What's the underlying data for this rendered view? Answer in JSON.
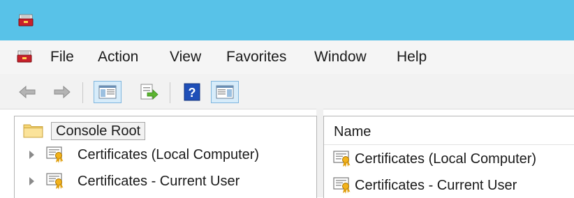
{
  "window": {
    "icon": "mmc-toolbox-icon"
  },
  "menu": {
    "icon": "mmc-toolbox-icon",
    "items": [
      "File",
      "Action",
      "View",
      "Favorites",
      "Window",
      "Help"
    ]
  },
  "toolbar": {
    "buttons": [
      "back-arrow-icon",
      "forward-arrow-icon",
      "show-hide-console-tree-icon",
      "export-list-icon",
      "help-icon",
      "show-hide-action-pane-icon"
    ]
  },
  "tree": {
    "root_label": "Console Root",
    "items": [
      {
        "label": "Certificates (Local Computer)"
      },
      {
        "label": "Certificates - Current User"
      }
    ]
  },
  "list": {
    "column_name": "Name",
    "items": [
      {
        "label": "Certificates (Local Computer)"
      },
      {
        "label": "Certificates - Current User"
      }
    ]
  },
  "colors": {
    "titlebar": "#58c2e8",
    "menubar": "#f5f5f5",
    "toolbar": "#f2f2f2"
  }
}
